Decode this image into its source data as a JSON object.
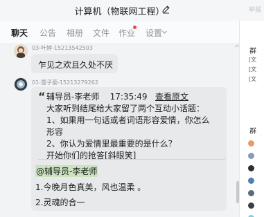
{
  "window": {
    "title": "计算机（物联网工程）",
    "right_hint": "举报"
  },
  "tabs": [
    {
      "label": "聊天",
      "active": true
    },
    {
      "label": "公告",
      "active": false
    },
    {
      "label": "相册",
      "active": false
    },
    {
      "label": "文件",
      "active": false
    },
    {
      "label": "作业",
      "active": false,
      "has_dot": true
    },
    {
      "label": "设置",
      "active": false,
      "has_dropdown": true
    }
  ],
  "messages": [
    {
      "sender": "03-叶婷-15213542503",
      "text": "乍见之欢且久处不厌"
    },
    {
      "sender": "01-雷子豪-15213279262",
      "quote": {
        "header_name": "辅导员-李老师",
        "header_time": "17:35:49",
        "header_link": "查看原文",
        "lines": [
          "大家听到结尾给大家留了两个互动小话题：",
          "1、如果用一句话或者词语形容爱情，你怎么",
          "形容",
          "2、你认为爱情里最重要的是什么？",
          "开始你们的抢答[斜眼笑]"
        ]
      },
      "reply": {
        "mention": "@辅导员-李老师",
        "lines": [
          "1.今晚月色真美，风也温柔 。",
          "2.灵魂的合一"
        ]
      }
    }
  ],
  "right_panel": {
    "heading_1": "群",
    "bracket_lines": [
      "[文",
      "[文",
      "[文"
    ],
    "heading_2": "群"
  },
  "colors": {
    "chat_bg": "#f2f3f5",
    "bubble": "#e8e9eb",
    "mention_bg": "#cbe3bf",
    "tab_dot": "#f0473a"
  }
}
